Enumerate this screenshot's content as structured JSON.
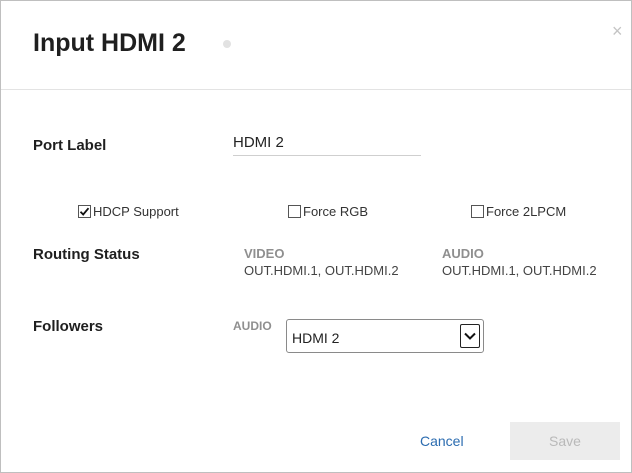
{
  "dialog": {
    "title": "Input HDMI 2",
    "close_glyph": "×"
  },
  "port_label": {
    "label": "Port Label",
    "value": "HDMI 2"
  },
  "options": {
    "hdcp": {
      "label": "HDCP Support",
      "checked": true
    },
    "force_rgb": {
      "label": "Force RGB",
      "checked": false
    },
    "force_2lpcm": {
      "label": "Force 2LPCM",
      "checked": false
    }
  },
  "routing_status": {
    "label": "Routing Status",
    "video_header": "VIDEO",
    "video_value": "OUT.HDMI.1, OUT.HDMI.2",
    "audio_header": "AUDIO",
    "audio_value": "OUT.HDMI.1, OUT.HDMI.2"
  },
  "followers": {
    "label": "Followers",
    "audio_label": "AUDIO",
    "selected": "HDMI 2"
  },
  "footer": {
    "cancel_label": "Cancel",
    "save_label": "Save"
  },
  "colors": {
    "link": "#2b6cb0",
    "disabled_button_bg": "#ececec",
    "disabled_button_text": "#b9b9b9",
    "muted_header": "#8f8f8f"
  },
  "icons": {
    "close": "close-icon",
    "checkbox_checked": "checkbox-checked-icon",
    "checkbox_empty": "checkbox-unchecked-icon",
    "dropdown": "chevron-down-icon"
  }
}
